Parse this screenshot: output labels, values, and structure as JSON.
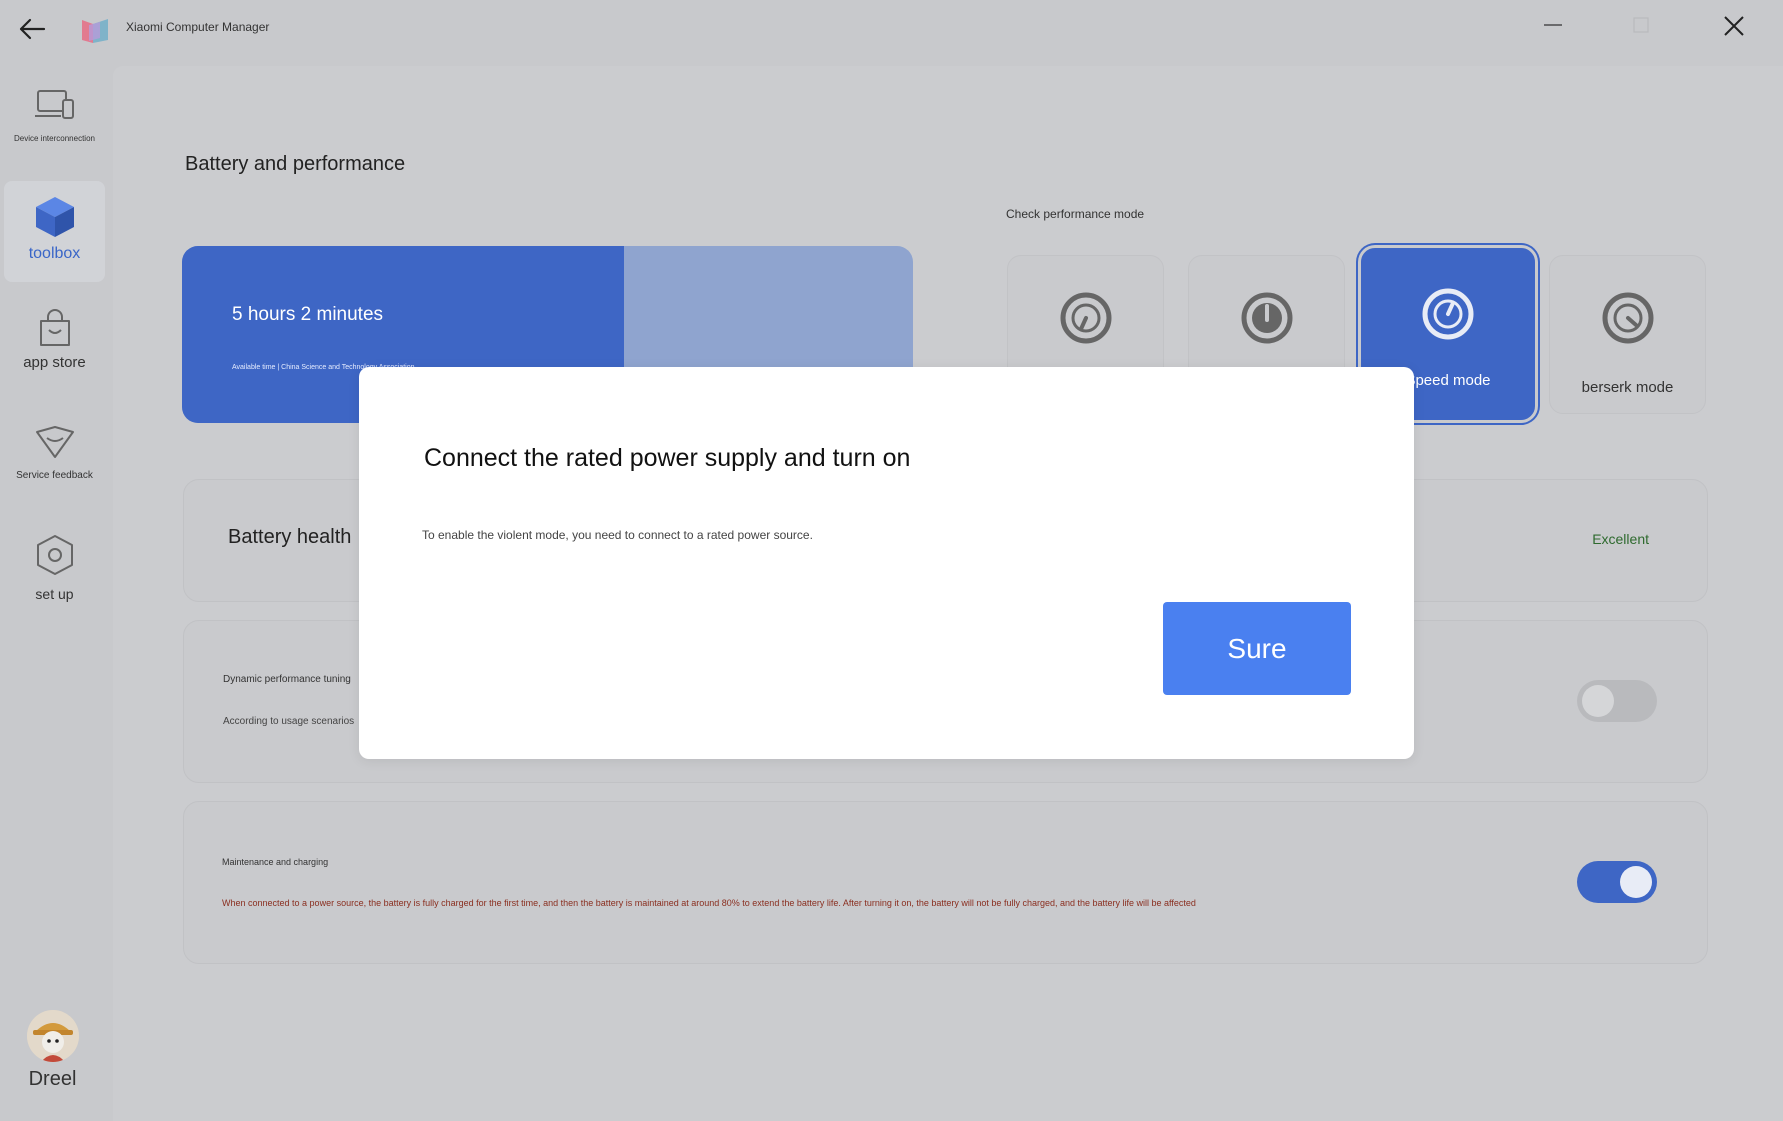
{
  "app": {
    "title": "Xiaomi Computer Manager"
  },
  "sidebar": {
    "items": [
      {
        "label": "Device interconnection",
        "icon": "devices-icon"
      },
      {
        "label": "toolbox",
        "icon": "cube-icon",
        "active": true
      },
      {
        "label": "app store",
        "icon": "shopping-bag-icon"
      },
      {
        "label": "Service feedback",
        "icon": "heart-badge-icon"
      },
      {
        "label": "set up",
        "icon": "settings-icon"
      }
    ],
    "user": {
      "name": "Dreel"
    }
  },
  "page": {
    "title": "Battery and performance"
  },
  "battery": {
    "time": "5 hours 2 minutes",
    "source": "Available time | China Science and Technology Association",
    "fill_fraction": 0.605
  },
  "performance": {
    "label": "Check performance mode",
    "modes": [
      {
        "label": "",
        "selected": false
      },
      {
        "label": "",
        "selected": false
      },
      {
        "label": "Speed mode",
        "selected": true
      },
      {
        "label": "berserk mode",
        "selected": false
      }
    ]
  },
  "health": {
    "label": "Battery health",
    "value": "Excellent",
    "value_color": "#2e6a2e"
  },
  "dynamic_tuning": {
    "title": "Dynamic performance tuning",
    "desc": "According to usage scenarios",
    "enabled": false
  },
  "maintenance": {
    "title": "Maintenance and charging",
    "desc": "When connected to a power source, the battery is fully charged for the first time, and then the battery is maintained at around 80% to extend the battery life. After turning it on, the battery will not be fully charged, and the battery life will be affected",
    "enabled": true
  },
  "dialog": {
    "title": "Connect the rated power supply and turn on",
    "body": "To enable the violent mode, you need to connect to a rated power source.",
    "confirm_label": "Sure"
  },
  "colors": {
    "accent": "#3e66c5",
    "button": "#4a80f0",
    "background": "#c8c9cc"
  }
}
